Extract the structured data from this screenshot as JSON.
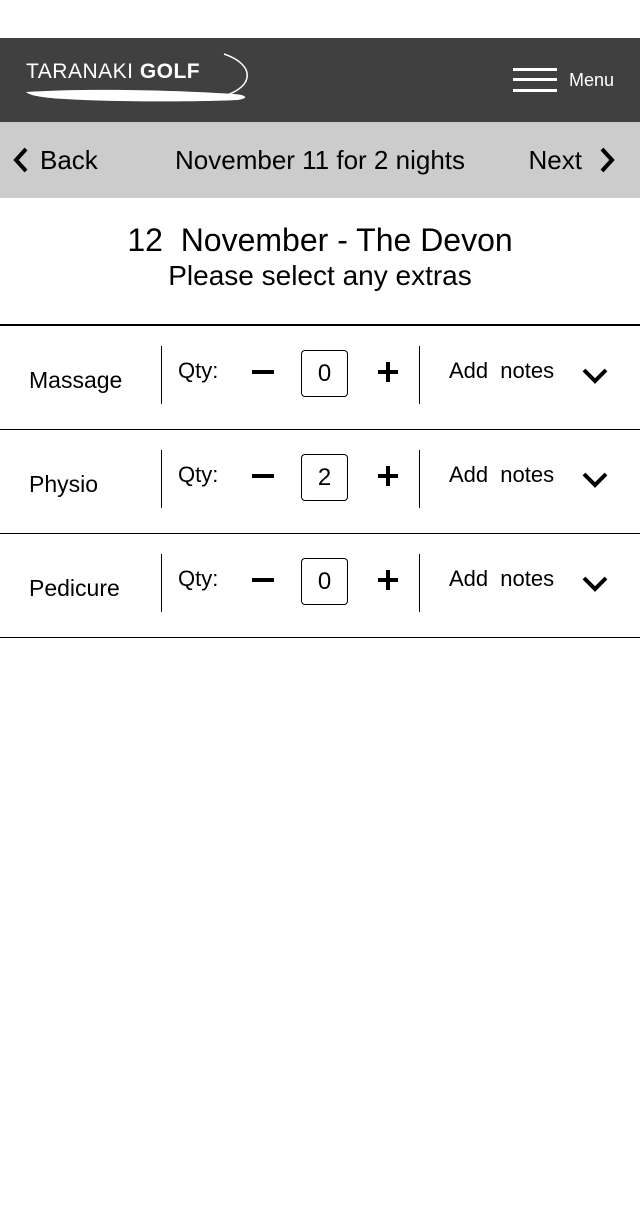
{
  "brand": {
    "name_light": "TARANAKI",
    "name_bold": "GOLF"
  },
  "header": {
    "menu_label": "Menu",
    "menu_icon": "hamburger-icon"
  },
  "subnav": {
    "back_label": "Back",
    "next_label": "Next",
    "title": "November 11 for 2 nights"
  },
  "page": {
    "date_title": "12  November - The Devon",
    "subtitle": "Please select any extras"
  },
  "extras": [
    {
      "name": "Massage",
      "qty_label": "Qty:",
      "qty": "0",
      "notes_label": "Add notes"
    },
    {
      "name": "Physio",
      "qty_label": "Qty:",
      "qty": "2",
      "notes_label": "Add notes"
    },
    {
      "name": "Pedicure",
      "qty_label": "Qty:",
      "qty": "0",
      "notes_label": "Add notes"
    }
  ],
  "colors": {
    "header_bg": "#404040",
    "subnav_bg": "#cccccc"
  }
}
